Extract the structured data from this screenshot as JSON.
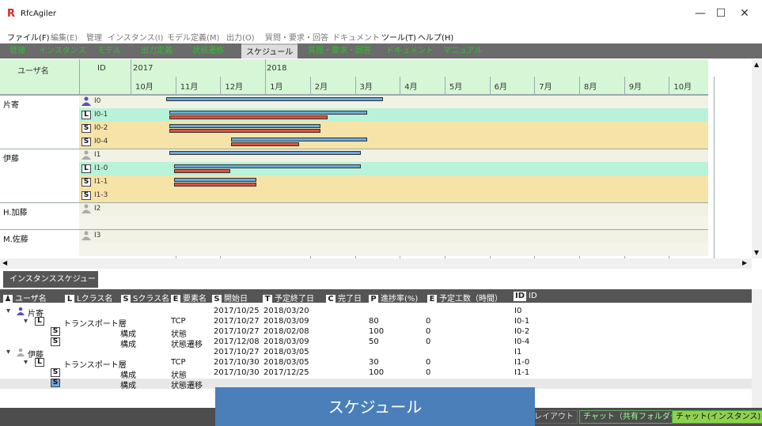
{
  "app": {
    "title": "RfcAgiler",
    "logo": "R"
  },
  "window": {
    "minimize": "—",
    "maximize": "☐",
    "close": "✕"
  },
  "menu": [
    "ファイル(F)",
    "編集(E)",
    "管理",
    "インスタンス(I)",
    "モデル定義(M)",
    "出力(O)",
    "質問・要求・回答",
    "ドキュメント",
    "ツール(T)",
    "ヘルプ(H)"
  ],
  "tabs": [
    "管理",
    "インスタンス",
    "モデル",
    "出力定義",
    "状態遷移",
    "スケジュール",
    "質問・要求・回答",
    "ドキュメント",
    "マニュアル"
  ],
  "active_tab": "スケジュール",
  "gantt": {
    "col_user": "ユーザ名",
    "col_id": "ID",
    "year1": "2017",
    "year2": "2018",
    "months": [
      "10月",
      "11月",
      "12月",
      "1月",
      "2月",
      "3月",
      "4月",
      "5月",
      "6月",
      "7月",
      "8月",
      "9月",
      "10月"
    ],
    "users": [
      {
        "name": "片寄",
        "rows": [
          {
            "type": "user",
            "id": "I0"
          },
          {
            "type": "L",
            "id": "I0-1"
          },
          {
            "type": "S",
            "id": "I0-2"
          },
          {
            "type": "S",
            "id": "I0-4"
          }
        ]
      },
      {
        "name": "伊藤",
        "rows": [
          {
            "type": "user",
            "id": "I1"
          },
          {
            "type": "L",
            "id": "I1-0"
          },
          {
            "type": "S",
            "id": "I1-1"
          },
          {
            "type": "S",
            "id": "I1-3"
          }
        ]
      },
      {
        "name": "H.加藤",
        "rows": [
          {
            "type": "user",
            "id": "I2"
          },
          {
            "type": "empty",
            "id": ""
          }
        ]
      },
      {
        "name": "M.佐藤",
        "rows": [
          {
            "type": "user",
            "id": "I3"
          },
          {
            "type": "empty",
            "id": ""
          }
        ]
      }
    ]
  },
  "schedule_panel": {
    "tab": "インスタンススケジュール",
    "headers": [
      {
        "chip": "user-icon",
        "label": "ユーザ名"
      },
      {
        "chip": "L",
        "label": "Lクラス名"
      },
      {
        "chip": "S",
        "label": "Sクラス名"
      },
      {
        "chip": "E",
        "label": "要素名"
      },
      {
        "chip": "S",
        "label": "開始日"
      },
      {
        "chip": "T",
        "label": "予定終了日"
      },
      {
        "chip": "C",
        "label": "完了日"
      },
      {
        "chip": "P",
        "label": "進捗率(%)"
      },
      {
        "chip": "E",
        "label": "予定工数（時間）"
      },
      {
        "chip": "ID",
        "label": "ID"
      }
    ],
    "rows": [
      {
        "level": 0,
        "user": "片寄",
        "lclass": "",
        "sclass": "",
        "element": "",
        "start": "2017/10/25",
        "end": "2018/03/20",
        "done": "",
        "progress": "",
        "effort": "",
        "id": "I0"
      },
      {
        "level": 1,
        "user": "",
        "lclass": "トランスポート層",
        "sclass": "",
        "element": "TCP",
        "start": "2017/10/27",
        "end": "2018/03/09",
        "done": "",
        "progress": "80",
        "effort": "0",
        "id": "I0-1"
      },
      {
        "level": 2,
        "user": "",
        "lclass": "",
        "sclass": "構成",
        "element": "状態",
        "start": "2017/10/27",
        "end": "2018/02/08",
        "done": "",
        "progress": "100",
        "effort": "0",
        "id": "I0-2"
      },
      {
        "level": 2,
        "user": "",
        "lclass": "",
        "sclass": "構成",
        "element": "状態遷移",
        "start": "2017/12/08",
        "end": "2018/03/09",
        "done": "",
        "progress": "50",
        "effort": "0",
        "id": "I0-4"
      },
      {
        "level": 0,
        "user": "伊藤",
        "lclass": "",
        "sclass": "",
        "element": "",
        "start": "2017/10/27",
        "end": "2018/03/05",
        "done": "",
        "progress": "",
        "effort": "",
        "id": "I1"
      },
      {
        "level": 1,
        "user": "",
        "lclass": "トランスポート層",
        "sclass": "",
        "element": "TCP",
        "start": "2017/10/30",
        "end": "2018/03/05",
        "done": "",
        "progress": "30",
        "effort": "0",
        "id": "I1-0"
      },
      {
        "level": 2,
        "user": "",
        "lclass": "",
        "sclass": "構成",
        "element": "状態",
        "start": "2017/10/30",
        "end": "2017/12/25",
        "done": "",
        "progress": "100",
        "effort": "0",
        "id": "I1-1"
      },
      {
        "level": 2,
        "user": "",
        "lclass": "",
        "sclass": "構成",
        "element": "状態遷移",
        "start": "",
        "end": "",
        "done": "",
        "progress": "",
        "effort": "",
        "id": ""
      }
    ]
  },
  "bottom": {
    "layout": "レイアウト",
    "chat_shared": "チャット（共有フォルダー）",
    "chat_instance": "チャット(インスタンス)"
  },
  "toast": "スケジュール",
  "colors": {
    "plan": "#6ea8d8",
    "actual": "#e05040",
    "header_green": "#d6f7d6",
    "row_user": "#f1f1e4",
    "row_L": "#b8f2d8",
    "row_S": "#f6e3a8"
  }
}
